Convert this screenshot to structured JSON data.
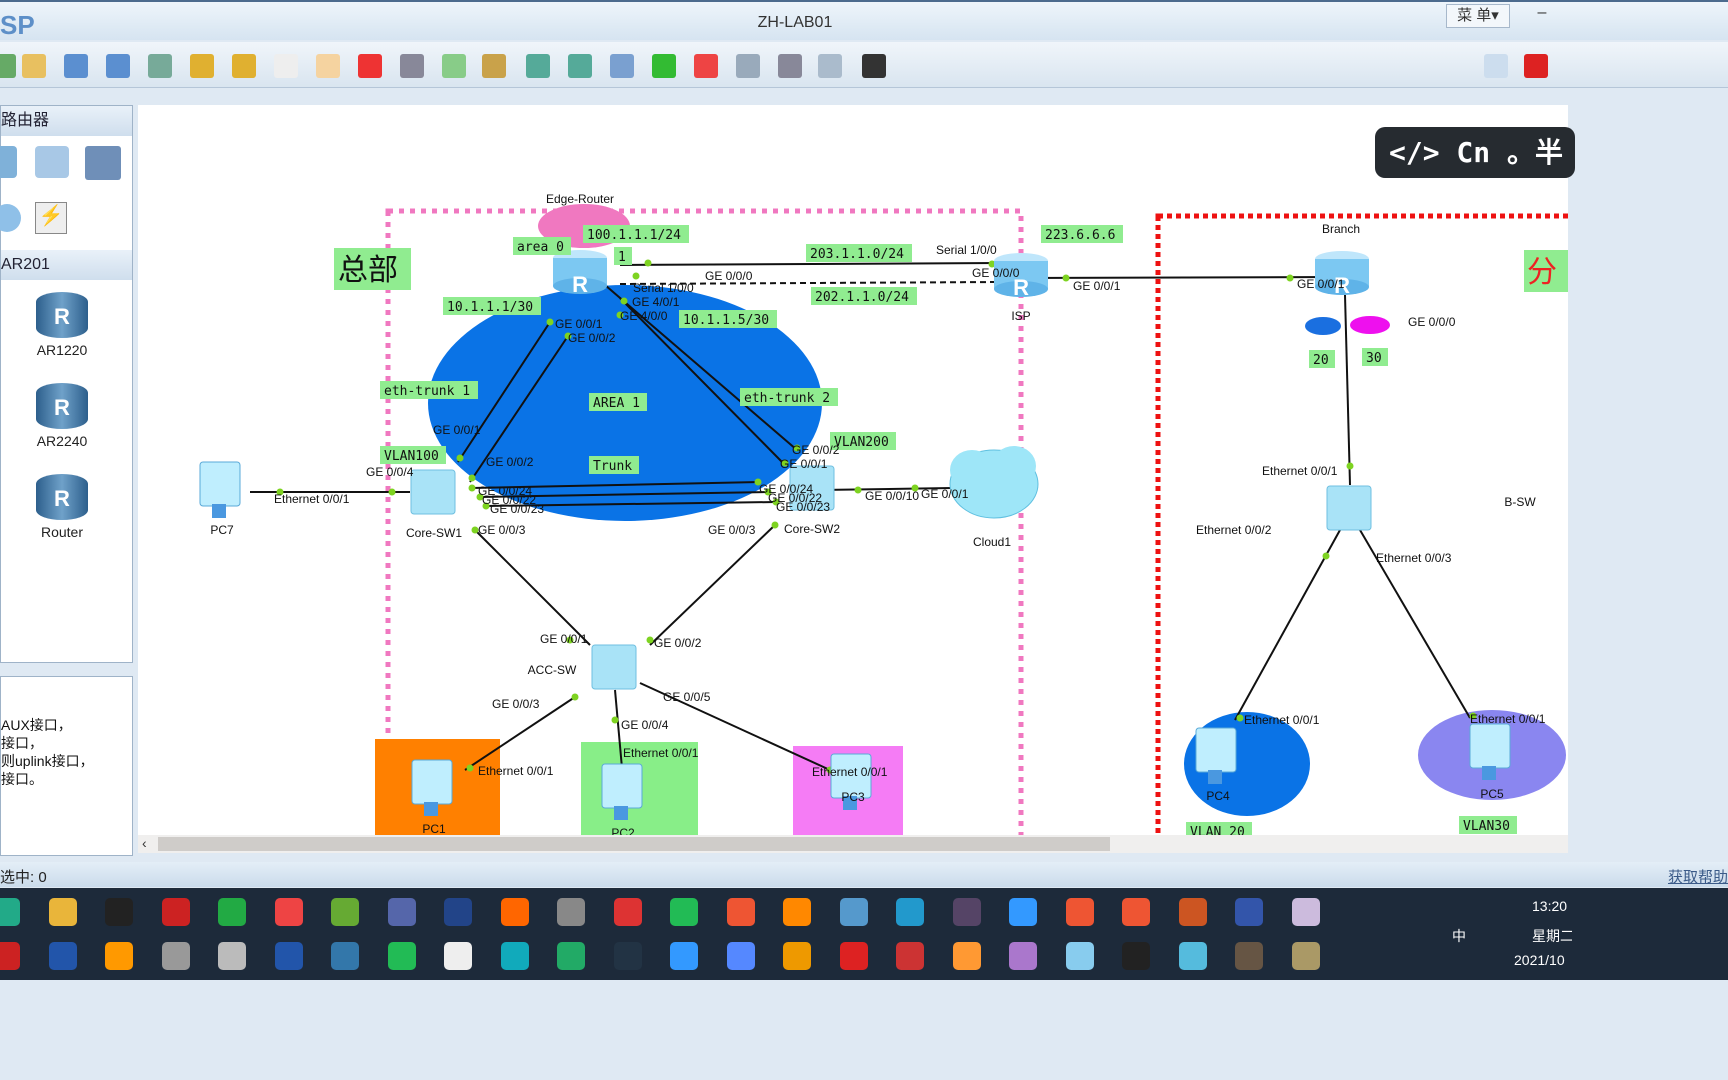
{
  "window": {
    "logo": "SP",
    "title": "ZH-LAB01",
    "menu_label": "菜 单▾",
    "minimize_label": "–"
  },
  "toolbar": {
    "icons": [
      "new-topology-icon",
      "open-icon",
      "save-icon",
      "save-as-icon",
      "print-icon",
      "undo-icon",
      "redo-icon",
      "select-pointer-icon",
      "pan-hand-icon",
      "delete-icon",
      "delete-link-icon",
      "text-comment-icon",
      "rectangle-icon",
      "zoom-in-icon",
      "zoom-out-icon",
      "fit-view-icon",
      "start-device-icon",
      "stop-device-icon",
      "capture-icon",
      "topology-icon",
      "grid-icon",
      "screenshot-icon",
      "chat-icon",
      "huawei-logo-icon"
    ]
  },
  "left_panel": {
    "category_title": "路由器",
    "subcategory_title": "AR201",
    "devices": [
      "AR1220",
      "AR2240",
      "Router"
    ],
    "description_lines": [
      "AUX接口，",
      "接口，",
      "则uplink接口，",
      "接口。"
    ]
  },
  "ime": {
    "text": "</> Cn 。半"
  },
  "topology": {
    "areas": [
      {
        "color": "#f078c0"
      },
      {
        "color": "#0a73e6"
      },
      {
        "color": "#ff8000"
      },
      {
        "color": "#88ee88"
      },
      {
        "color": "#f57cf5"
      },
      {
        "color": "#0a73e6"
      },
      {
        "color": "#8a86f0"
      },
      {
        "color": "#1a6fe0"
      },
      {
        "color": "#ee10ee"
      }
    ],
    "device_labels": [
      "Edge-Router",
      "ISP",
      "Branch",
      "Core-SW1",
      "Core-SW2",
      "ACC-SW",
      "B-SW",
      "PC7",
      "Cloud1",
      "PC1",
      "PC2",
      "PC3",
      "PC4",
      "PC5"
    ],
    "notes": [
      "100.1.1.1/24",
      "area 0",
      "1",
      "203.1.1.0/24",
      "202.1.1.0/24",
      "223.6.6.6",
      "10.1.1.1/30",
      "10.1.1.5/30",
      "eth-trunk 1",
      "AREA 1",
      "eth-trunk 2",
      "VLAN100",
      "VLAN200",
      "Trunk",
      "20",
      "30",
      "VLAN 20",
      "VLAN30"
    ],
    "zone_labels": [
      "总部",
      "分"
    ],
    "port_labels": [
      "Serial 1/0/0",
      "GE 0/0/0",
      "Serial 1/0/0",
      "GE 4/0/1",
      "GE 4/0/0",
      "GE 0/0/1",
      "GE 0/0/2",
      "GE 0/0/0",
      "GE 0/0/1",
      "GE 0/0/1",
      "GE 0/0/0",
      "GE 0/0/1",
      "GE 0/0/2",
      "GE 0/0/4",
      "Ethernet 0/0/1",
      "GE 0/0/24",
      "GE 0/0/22",
      "GE 0/0/23",
      "GE 0/0/3",
      "GE 0/0/2",
      "GE 0/0/1",
      "GE 0/0/24",
      "GE 0/0/22",
      "GE 0/0/23",
      "GE 0/0/10",
      "GE 0/0/1",
      "GE 0/0/3",
      "Ethernet 0/0/1",
      "Ethernet 0/0/2",
      "Ethernet 0/0/3",
      "GE 0/0/1",
      "GE 0/0/2",
      "GE 0/0/3",
      "GE 0/0/4",
      "GE 0/0/5",
      "Ethernet 0/0/1",
      "Ethernet 0/0/1",
      "Ethernet 0/0/1",
      "Ethernet 0/0/1",
      "Ethernet 0/0/1"
    ]
  },
  "status": {
    "selected": "选中: 0",
    "help": "获取帮助"
  },
  "taskbar": {
    "clock": "13:20",
    "weekday": "星期二",
    "date": "2021/10",
    "ime": "中"
  }
}
